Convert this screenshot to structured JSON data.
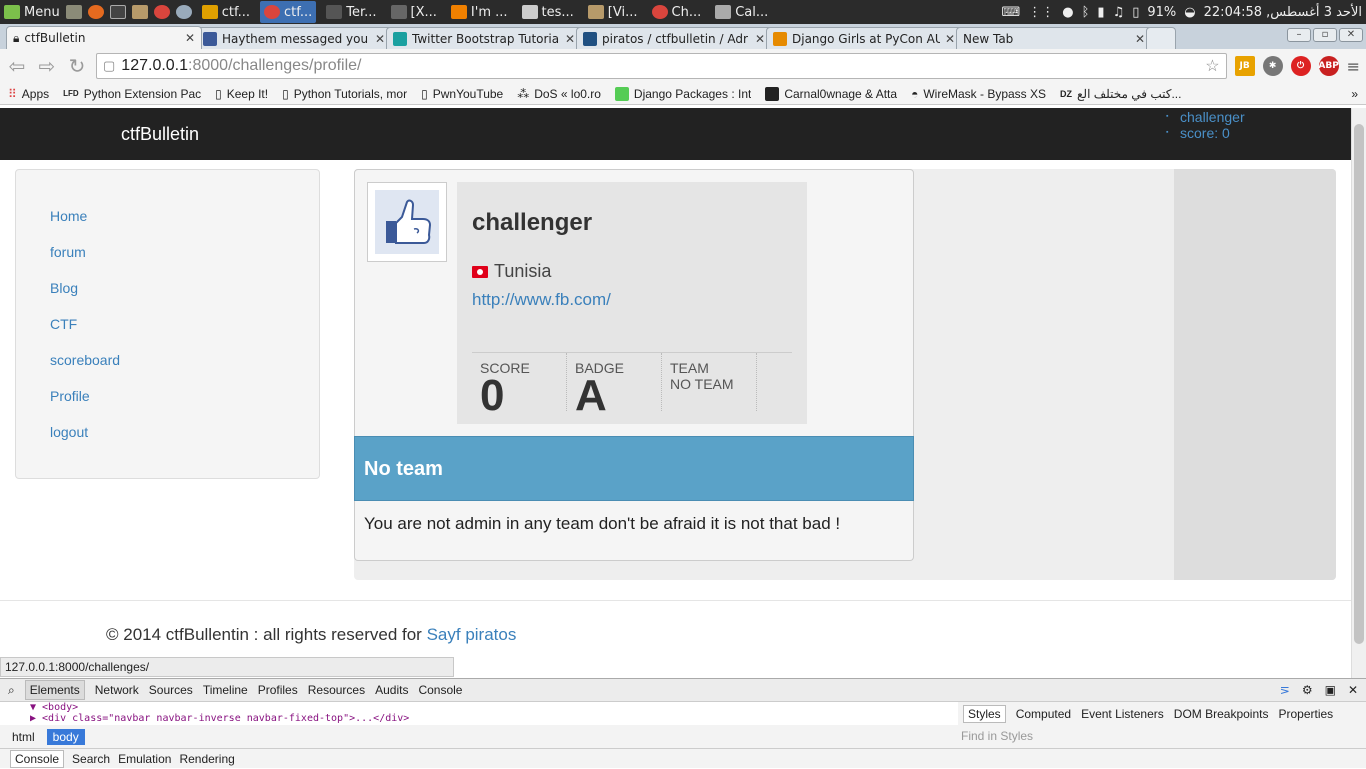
{
  "system": {
    "menu_label": "Menu",
    "taskbar": [
      "ctf...",
      "ctf...",
      "Ter...",
      "[X...",
      "I'm ...",
      "tes...",
      "[Vi...",
      "Ch...",
      "Cal..."
    ],
    "battery": "91%",
    "clock": "الأحد 3 أغسطس, 22:04:58"
  },
  "browser": {
    "tabs": [
      {
        "title": "ctfBulletin",
        "icon": "lock-icon"
      },
      {
        "title": "Haythem messaged you",
        "icon": "facebook-icon"
      },
      {
        "title": "Twitter Bootstrap Tutoria",
        "icon": "bootstrap-icon"
      },
      {
        "title": "piratos / ctfbulletin / Adr",
        "icon": "bitbucket-icon"
      },
      {
        "title": "Django Girls at PyCon AU",
        "icon": "django-icon"
      },
      {
        "title": "New Tab",
        "icon": ""
      }
    ],
    "url_host": "127.0.0.1",
    "url_path": ":8000/challenges/profile/",
    "bookmarks": [
      "Apps",
      "Python Extension Pac",
      "Keep It!",
      "Python Tutorials, mor",
      "PwnYouTube",
      "DoS « lo0.ro",
      "Django Packages : Int",
      "Carnal0wnage & Atta",
      "WireMask - Bypass XS",
      "كتب في مختلف الع..."
    ],
    "status_url": "127.0.0.1:8000/challenges/"
  },
  "site": {
    "brand": "ctfBulletin",
    "nav_user": "challenger",
    "nav_score": "score: 0",
    "sidebar": [
      "Home",
      "forum",
      "Blog",
      "CTF",
      "scoreboard",
      "Profile",
      "logout"
    ]
  },
  "profile": {
    "username": "challenger",
    "country": "Tunisia",
    "website": "http://www.fb.com/",
    "score_label": "SCORE",
    "score": "0",
    "badge_label": "BADGE",
    "badge": "A",
    "team_label": "TEAM",
    "team": "NO TEAM"
  },
  "team_panel": {
    "heading": "No team",
    "message": "You are not admin in any team don't be afraid it is not that bad !"
  },
  "footer": {
    "text": "© 2014 ctfBullentin : all rights reserved for ",
    "link": "Sayf piratos"
  },
  "devtools": {
    "tabs": [
      "Elements",
      "Network",
      "Sources",
      "Timeline",
      "Profiles",
      "Resources",
      "Audits",
      "Console"
    ],
    "code_line1": "▼ <body>",
    "code_line2": "  ▶ <div class=\"navbar navbar-inverse navbar-fixed-top\">...</div>",
    "crumbs": [
      "html",
      "body"
    ],
    "style_tabs": [
      "Styles",
      "Computed",
      "Event Listeners",
      "DOM Breakpoints",
      "Properties"
    ],
    "find_placeholder": "Find in Styles",
    "drawer_tabs": [
      "Console",
      "Search",
      "Emulation",
      "Rendering"
    ]
  },
  "colors": {
    "link": "#3a80bb",
    "navbar": "#222222",
    "team_header": "#5aa2c8"
  }
}
